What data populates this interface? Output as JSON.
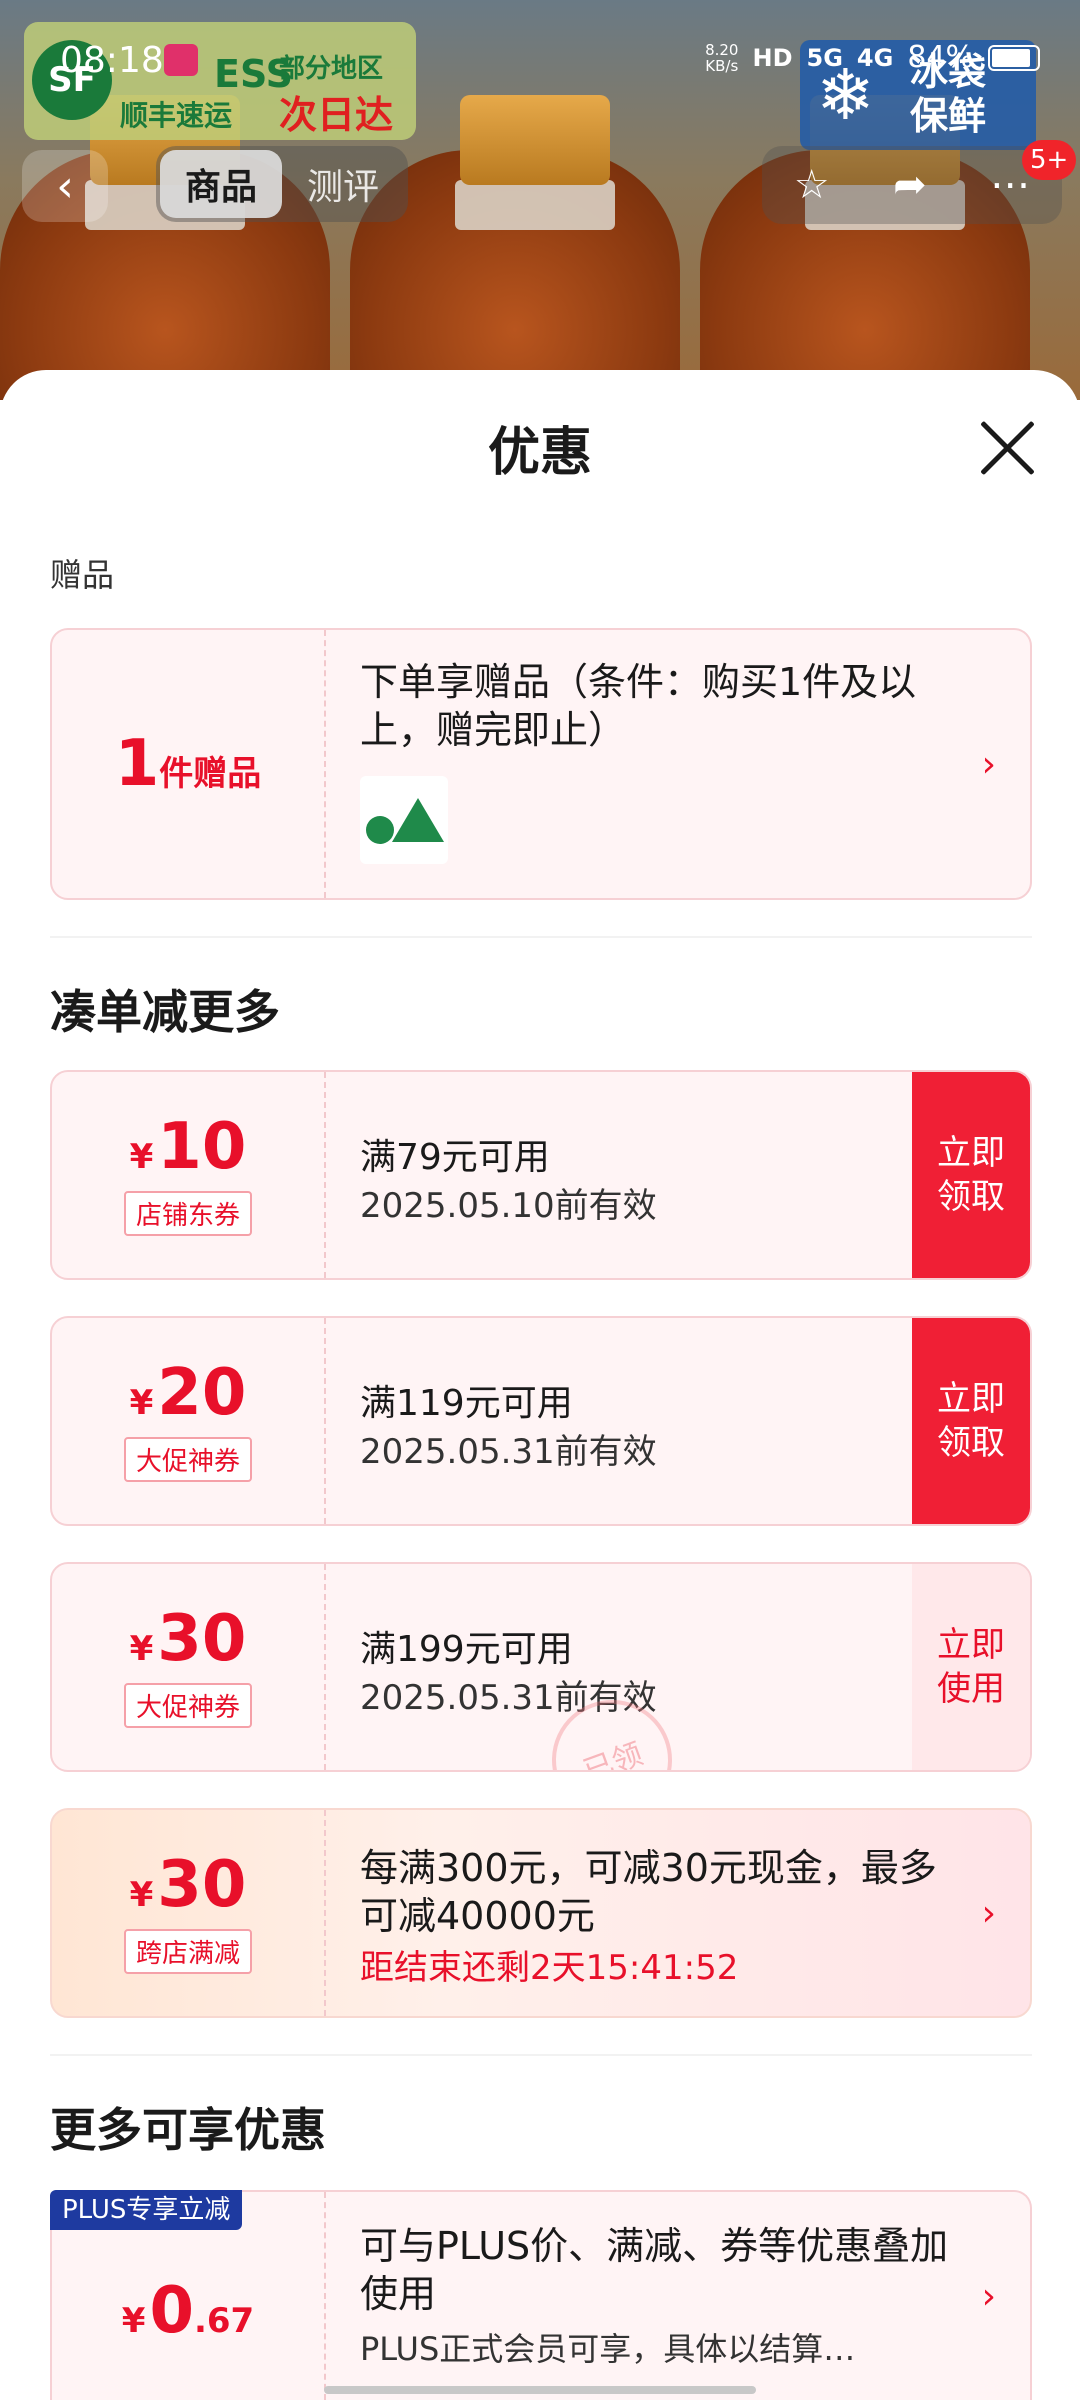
{
  "status_bar": {
    "time": "08:18",
    "net_speed_value": "8.20",
    "net_speed_unit": "KB/s",
    "hd": "HD",
    "sig1": "5G",
    "sig2": "4G",
    "battery": "84%"
  },
  "product_banner": {
    "sf_logo": "SF",
    "sf_ess": "ESS",
    "sf_express": "顺丰速运",
    "sf_region": "部分地区",
    "sf_nextday": "次日达",
    "ice_text": "冰袋保鲜"
  },
  "nav": {
    "tabs": [
      {
        "label": "商品",
        "active": true
      },
      {
        "label": "测评",
        "active": false
      }
    ],
    "badge": "5+"
  },
  "sheet": {
    "title": "优惠",
    "gift_section_label": "赠品",
    "gift": {
      "count": "1",
      "unit": "件赠品",
      "description": "下单享赠品（条件：购买1件及以上，赠完即止）"
    },
    "coupon_section_title": "凑单减更多",
    "coupons": [
      {
        "yen": "¥",
        "amount": "10",
        "tag": "店铺东券",
        "condition": "满79元可用",
        "expiry": "2025.05.10前有效",
        "action": "立即\n领取",
        "state": "claim"
      },
      {
        "yen": "¥",
        "amount": "20",
        "tag": "大促神券",
        "condition": "满119元可用",
        "expiry": "2025.05.31前有效",
        "action": "立即\n领取",
        "state": "claim"
      },
      {
        "yen": "¥",
        "amount": "30",
        "tag": "大促神券",
        "condition": "满199元可用",
        "expiry": "2025.05.31前有效",
        "action": "立即\n使用",
        "state": "use",
        "stamp": "已领"
      }
    ],
    "promo": {
      "yen": "¥",
      "amount": "30",
      "tag": "跨店满减",
      "description": "每满300元，可减30元现金，最多可减40000元",
      "countdown": "距结束还剩2天15:41:52"
    },
    "more_section_title": "更多可享优惠",
    "plus": {
      "tag": "PLUS专享立减",
      "yen": "¥",
      "amount_int": "0",
      "amount_dec": ".67",
      "description": "可与PLUS价、满减、券等优惠叠加使用",
      "note": "PLUS正式会员可享，具体以结算…"
    }
  },
  "colors": {
    "accent_red": "#e8102a",
    "button_red": "#f01f35",
    "plus_blue": "#1e3aa0"
  }
}
